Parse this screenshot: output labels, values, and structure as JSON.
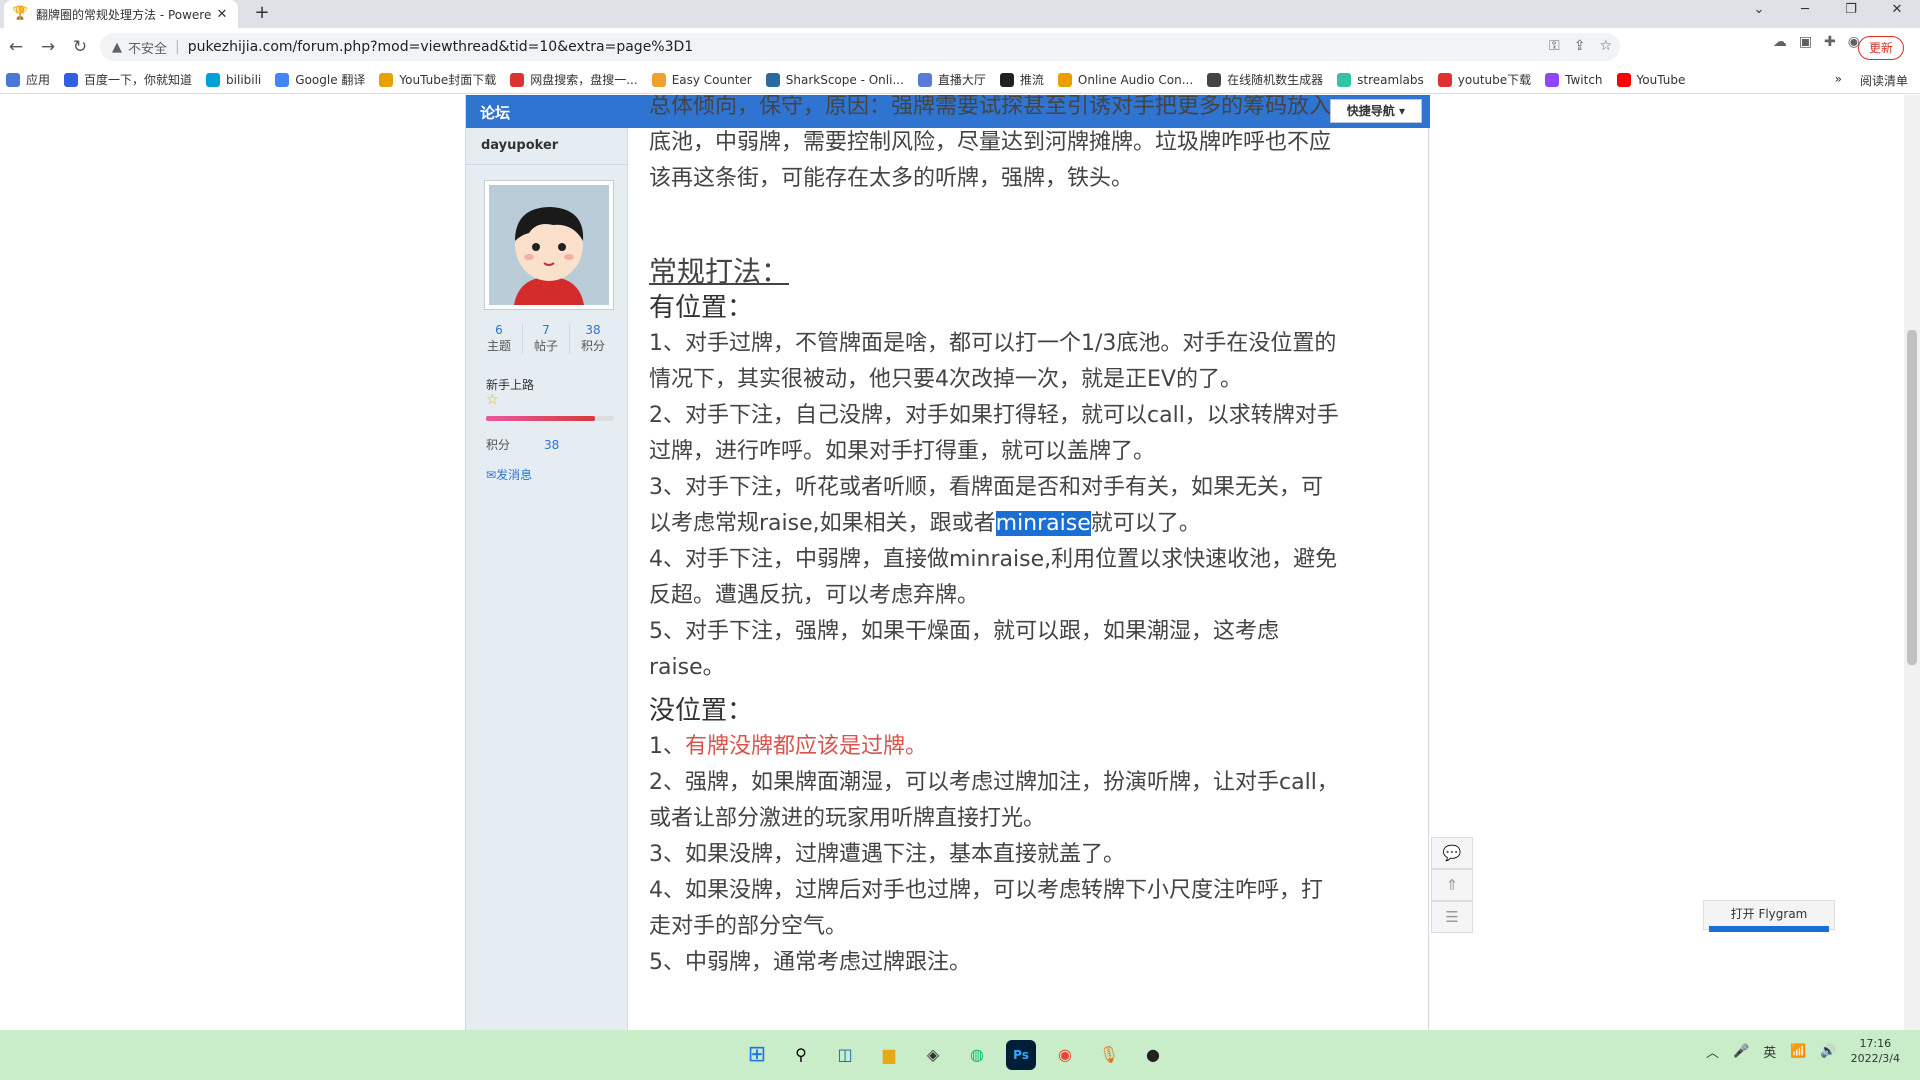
{
  "browser": {
    "tab_title": "翻牌圈的常规处理方法 - Powere",
    "tab_close": "✕",
    "new_tab": "+",
    "url": "pukezhijia.com/forum.php?mod=viewthread&tid=10&extra=page%3D1",
    "insecure_label": "不安全",
    "update_label": "更新"
  },
  "bookmarks": [
    {
      "label": "应用",
      "color": "#4a76d6"
    },
    {
      "label": "百度一下，你就知道",
      "color": "#3060e0"
    },
    {
      "label": "bilibili",
      "color": "#00a1d6"
    },
    {
      "label": "Google 翻译",
      "color": "#4285f4"
    },
    {
      "label": "YouTube封面下载",
      "color": "#e8a000"
    },
    {
      "label": "网盘搜索，盘搜一...",
      "color": "#d33"
    },
    {
      "label": "Easy Counter",
      "color": "#f0a030"
    },
    {
      "label": "SharkScope - Onli...",
      "color": "#2a6aa0"
    },
    {
      "label": "直播大厅",
      "color": "#5a7ad8"
    },
    {
      "label": "推流",
      "color": "#222"
    },
    {
      "label": "Online Audio Con...",
      "color": "#e8a000"
    },
    {
      "label": "在线随机数生成器",
      "color": "#444"
    },
    {
      "label": "streamlabs",
      "color": "#31c3a2"
    },
    {
      "label": "youtube下载",
      "color": "#e03030"
    },
    {
      "label": "Twitch",
      "color": "#9146ff"
    },
    {
      "label": "YouTube",
      "color": "#ff0000"
    }
  ],
  "bookmarks_more": "»",
  "reading_list": "阅读清单",
  "forum": {
    "logo": "论坛",
    "quick_nav": "快捷导航 ▾",
    "user": {
      "name": "dayupoker",
      "stats": [
        {
          "num": "6",
          "label": "主题"
        },
        {
          "num": "7",
          "label": "帖子"
        },
        {
          "num": "38",
          "label": "积分"
        }
      ],
      "rank": "新手上路",
      "points_label": "积分",
      "points_value": "38",
      "message": "发消息",
      "progress": 0.85
    }
  },
  "post": {
    "line0": "总体倾向，保守，原因：强牌需要试探甚至引诱对手把更多的筹码放入",
    "line1": "底池，中弱牌，需要控制风险，尽量达到河牌摊牌。垃圾牌咋呼也不应",
    "line2": "该再这条街，可能存在太多的听牌，强牌，铁头。",
    "heading_main": "常规打法：",
    "heading_pos": "有位置：",
    "pos_lines": [
      "1、对手过牌，不管牌面是啥，都可以打一个1/3底池。对手在没位置的",
      "情况下，其实很被动，他只要4次改掉一次，就是正EV的了。",
      "2、对手下注，自己没牌，对手如果打得轻，就可以call，以求转牌对手",
      "过牌，进行咋呼。如果对手打得重，就可以盖牌了。",
      "3、对手下注，听花或者听顺，看牌面是否和对手有关，如果无关，可",
      "以考虑常规raise,如果相关，跟或者",
      "minraise",
      "就可以了。",
      "4、对手下注，中弱牌，直接做minraise,利用位置以求快速收池，避免",
      "反超。遭遇反抗，可以考虑弃牌。",
      "5、对手下注，强牌，如果干燥面，就可以跟，如果潮湿，这考虑",
      "raise。"
    ],
    "heading_nopos": "没位置：",
    "nopos_line1_prefix": "1、",
    "nopos_line1_red": "有牌没牌都应该是过牌。",
    "nopos_lines": [
      "2、强牌，如果牌面潮湿，可以考虑过牌加注，扮演听牌，让对手call，",
      "或者让部分激进的玩家用听牌直接打光。",
      "3、如果没牌，过牌遭遇下注，基本直接就盖了。",
      "4、如果没牌，过牌后对手也过牌，可以考虑转牌下小尺度注咋呼，打",
      "走对手的部分空气。",
      "5、中弱牌，通常考虑过牌跟注。"
    ]
  },
  "flygram": "打开 Flygram",
  "taskbar": {
    "ime": "英",
    "time": "17:16",
    "date": "2022/3/4"
  }
}
